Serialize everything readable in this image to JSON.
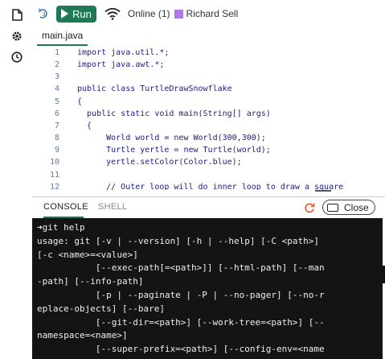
{
  "toolbar": {
    "run_label": "Run",
    "online_text": "Online (1)",
    "user_color": "#b277e6",
    "user_name": "Richard Sell"
  },
  "editor": {
    "file_tab": "main.java",
    "lines": [
      {
        "num": "1",
        "text": "import java.util.*;"
      },
      {
        "num": "2",
        "text": "import java.awt.*;"
      },
      {
        "num": "3",
        "text": ""
      },
      {
        "num": "4",
        "text": "public class TurtleDrawSnowflake"
      },
      {
        "num": "5",
        "text": "{"
      },
      {
        "num": "6",
        "text": "  public static void main(String[] args)"
      },
      {
        "num": "7",
        "text": "  {"
      },
      {
        "num": "8",
        "text": "      World world = new World(300,300);"
      },
      {
        "num": "9",
        "text": "      Turtle yertle = new Turtle(world);"
      },
      {
        "num": "10",
        "text": "      yertle.setColor(Color.blue);"
      },
      {
        "num": "11",
        "text": ""
      },
      {
        "num": "12",
        "text": "      // Outer loop will do inner loop to draw a square"
      }
    ]
  },
  "console": {
    "tab_console": "CONSOLE",
    "tab_shell": "SHELL",
    "close_label": "Close",
    "lines": [
      "➜git help",
      "usage: git [-v | --version] [-h | --help] [-C <path>]",
      "[-c <name>=<value>]",
      "           [--exec-path[=<path>]] [--html-path] [--man",
      "-path] [--info-path]",
      "           [-p | --paginate | -P | --no-pager] [--no-r",
      "eplace-objects] [--bare]",
      "           [--git-dir=<path>] [--work-tree=<path>] [--",
      "namespace=<name>]",
      "           [--super-prefix=<path>] [--config-env=<name"
    ]
  },
  "colors": {
    "run_green": "#1e7a55",
    "terminal_bg": "#141414",
    "refresh_orange": "#e8643a"
  }
}
